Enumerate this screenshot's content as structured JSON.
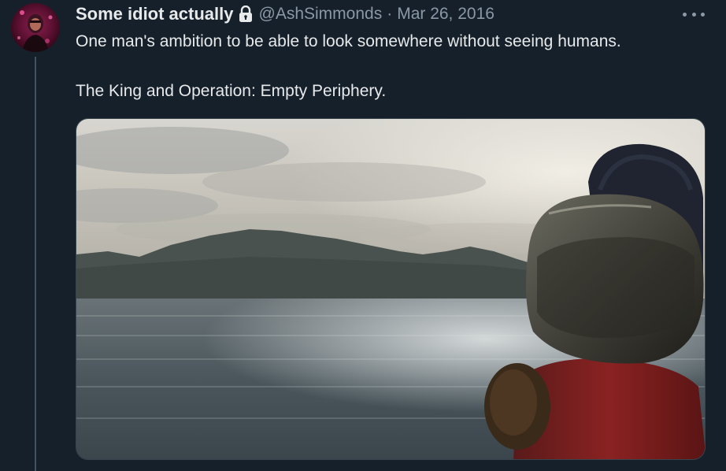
{
  "tweet": {
    "display_name": "Some idiot actually",
    "handle": "@AshSimmonds",
    "separator": "·",
    "date": "Mar 26, 2016",
    "text_line1": "One man's ambition to be able to look somewhere without seeing humans.",
    "text_line2": "The King and Operation: Empty Periphery.",
    "avatar_icon": "user-avatar",
    "protected_icon": "lock-icon",
    "more_icon": "more-options-icon",
    "media_description": "photo-icon"
  },
  "colors": {
    "background": "#15202b",
    "primary_text": "#e7e9ea",
    "secondary_text": "#8b98a5",
    "thread_line": "#425364"
  }
}
